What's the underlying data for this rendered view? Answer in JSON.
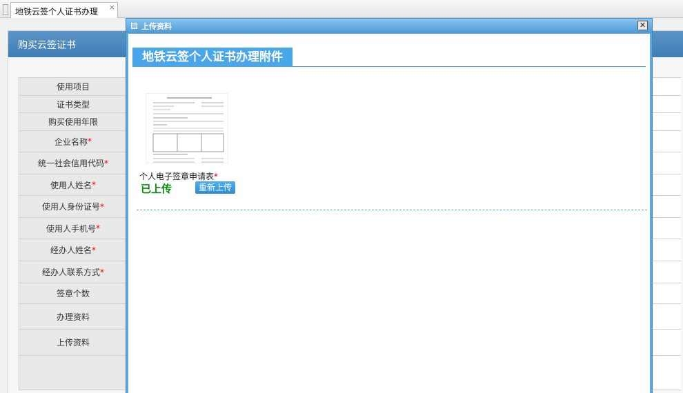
{
  "tab": {
    "title": "地铁云签个人证书办理",
    "close": "×"
  },
  "panel": {
    "title": "购买云签证书",
    "rows": [
      {
        "label": "使用项目",
        "required": false
      },
      {
        "label": "证书类型",
        "required": false
      },
      {
        "label": "购买使用年限",
        "required": false
      },
      {
        "label": "企业名称",
        "required": true
      },
      {
        "label": "统一社会信用代码",
        "required": true
      },
      {
        "label": "使用人姓名",
        "required": true
      },
      {
        "label": "使用人身份证号",
        "required": true
      },
      {
        "label": "使用人手机号",
        "required": true
      },
      {
        "label": "经办人姓名",
        "required": true
      },
      {
        "label": "经办人联系方式",
        "required": true
      },
      {
        "label": "签章个数",
        "required": false
      },
      {
        "label": "办理资料",
        "required": false
      },
      {
        "label": "上传资料",
        "required": false
      },
      {
        "label": "",
        "required": false
      }
    ]
  },
  "modal": {
    "title": "上传资料",
    "close": "✕",
    "heading": "地铁云签个人证书办理附件",
    "document": {
      "label": "个人电子签章申请表",
      "required_mark": "*",
      "status": "已上传",
      "reupload": "重新上传"
    }
  },
  "required_mark": "*",
  "colors": {
    "panel_header": "#4a86bd",
    "modal_frame": "#5ea7d8",
    "heading_bg": "#4aa6ea",
    "status_green": "#0a8a0a",
    "required_red": "#e00000"
  }
}
